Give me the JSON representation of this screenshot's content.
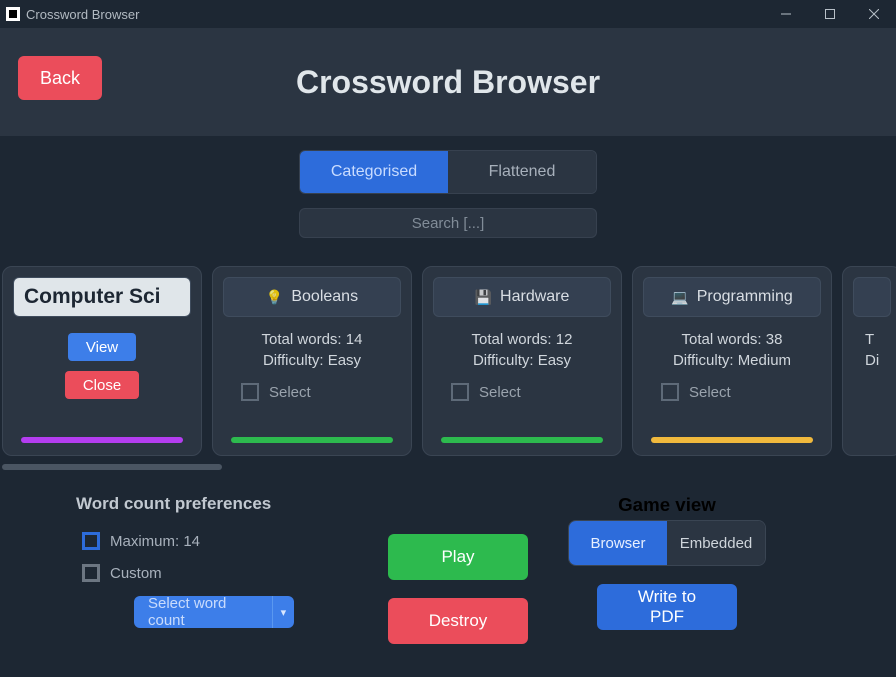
{
  "titlebar": {
    "title": "Crossword Browser"
  },
  "header": {
    "back": "Back",
    "title": "Crossword Browser"
  },
  "tabs": {
    "categorised": "Categorised",
    "flattened": "Flattened"
  },
  "search": {
    "placeholder": "Search [...]"
  },
  "cards": {
    "category": {
      "title": "Computer Sci",
      "view": "View",
      "close": "Close",
      "bar_color": "#b43df0"
    },
    "items": [
      {
        "icon": "bulb",
        "title": "Booleans",
        "total_label": "Total words: 14",
        "diff_label": "Difficulty: Easy",
        "select": "Select",
        "bar_color": "#2dba4e"
      },
      {
        "icon": "save",
        "title": "Hardware",
        "total_label": "Total words: 12",
        "diff_label": "Difficulty: Easy",
        "select": "Select",
        "bar_color": "#2dba4e"
      },
      {
        "icon": "laptop",
        "title": "Programming",
        "total_label": "Total words: 38",
        "diff_label": "Difficulty: Medium",
        "select": "Select",
        "bar_color": "#f0b93d"
      }
    ],
    "overflow": {
      "total_prefix": "T",
      "diff_prefix": "Di"
    }
  },
  "prefs": {
    "heading": "Word count preferences",
    "max_label": "Maximum: 14",
    "custom_label": "Custom",
    "select_count": "Select word count"
  },
  "actions": {
    "play": "Play",
    "destroy": "Destroy",
    "pdf": "Write to PDF"
  },
  "game_view": {
    "heading": "Game view",
    "browser": "Browser",
    "embedded": "Embedded"
  }
}
